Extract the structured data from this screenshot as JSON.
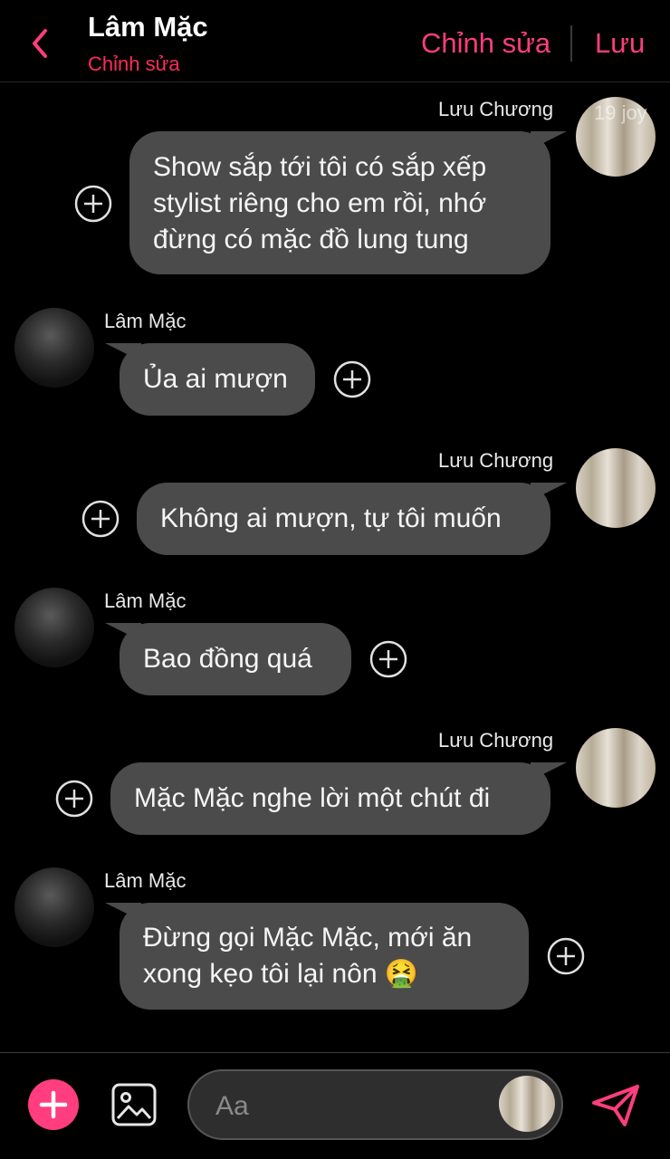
{
  "header": {
    "title": "Lâm Mặc",
    "subtitle": "Chỉnh sửa",
    "edit_label": "Chỉnh sửa",
    "save_label": "Lưu"
  },
  "watermark": "19 joy",
  "messages": [
    {
      "sender": "Lưu Chương",
      "side": "right",
      "lines": [
        "Show sắp tới tôi có sắp xếp",
        "stylist riêng cho em rồi, nhớ",
        "đừng có mặc đồ lung tung"
      ]
    },
    {
      "sender": "Lâm Mặc",
      "side": "left",
      "lines": [
        "Ủa ai mượn"
      ]
    },
    {
      "sender": "Lưu Chương",
      "side": "right",
      "lines": [
        "Không ai mượn, tự tôi muốn"
      ]
    },
    {
      "sender": "Lâm Mặc",
      "side": "left",
      "lines": [
        "Bao đồng quá"
      ]
    },
    {
      "sender": "Lưu Chương",
      "side": "right",
      "lines": [
        "Mặc Mặc nghe lời một chút đi"
      ]
    },
    {
      "sender": "Lâm Mặc",
      "side": "left",
      "lines": [
        "Đừng gọi Mặc Mặc, mới ăn",
        "xong kẹo tôi lại nôn 🤮"
      ]
    }
  ],
  "composer": {
    "placeholder": "Aa"
  },
  "colors": {
    "accent": "#ff3d7f",
    "subtitle": "#ff2d55",
    "bubble": "#4b4b4b"
  },
  "icons": [
    "back-chevron-icon",
    "add-reaction-icon",
    "plus-icon",
    "image-icon",
    "send-icon"
  ]
}
